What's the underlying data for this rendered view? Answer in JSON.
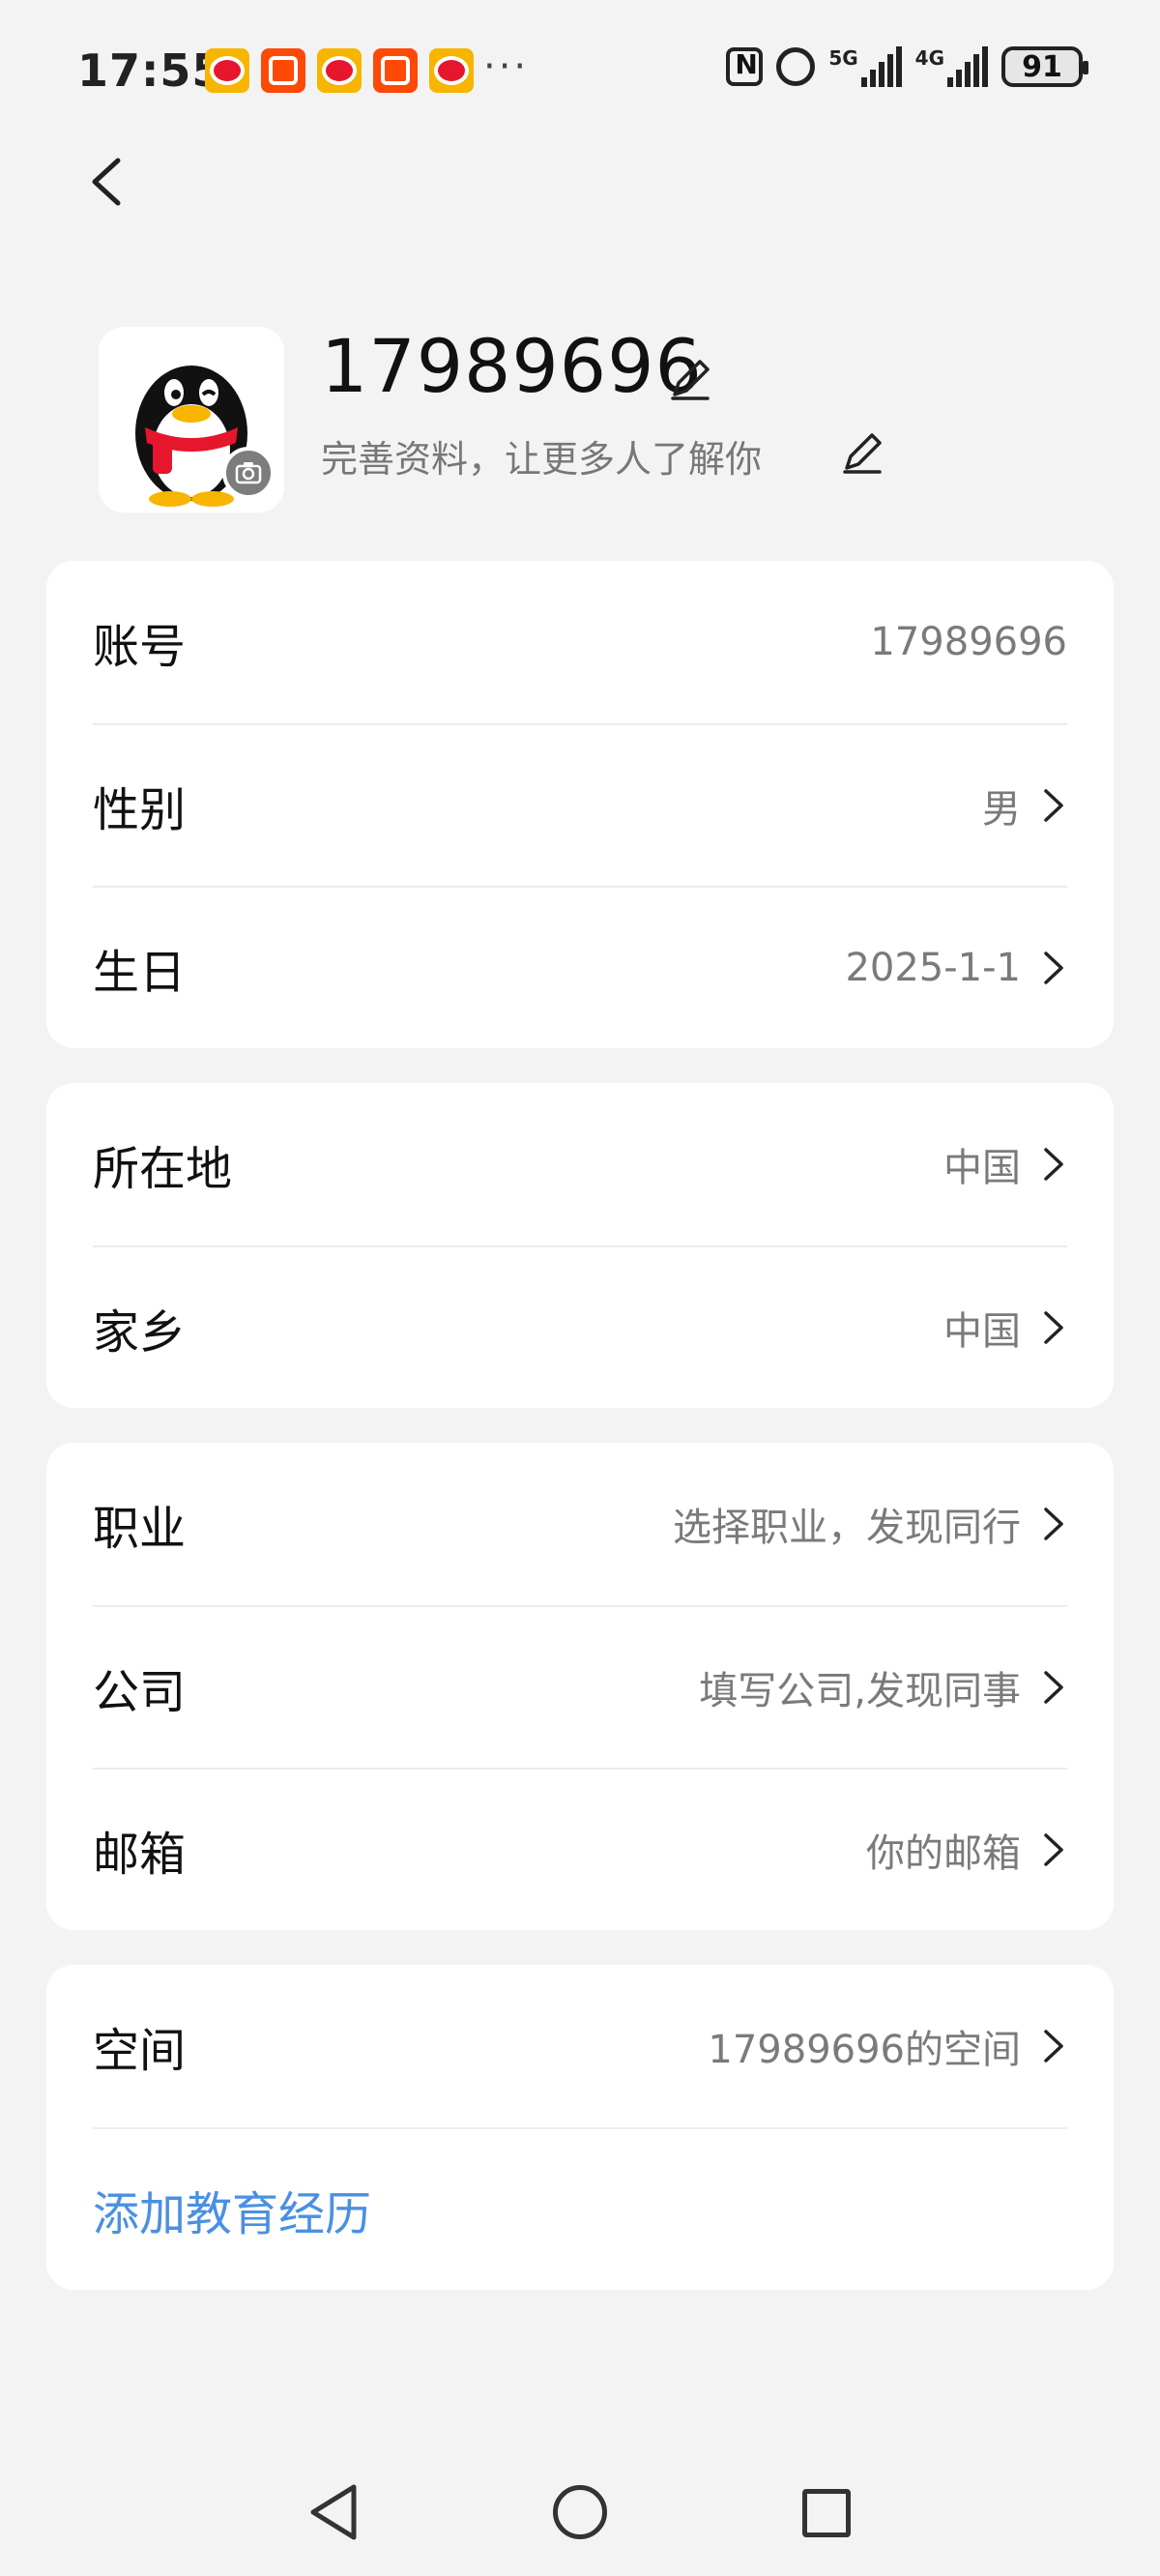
{
  "status_bar": {
    "time": "17:55",
    "notifications": [
      "weibo-icon",
      "kuaishou-icon",
      "weibo-icon",
      "kuaishou-icon",
      "weibo-icon"
    ],
    "more": "···",
    "battery": "91",
    "signal_1": "5G",
    "signal_2": "4G"
  },
  "profile": {
    "nickname": "17989696",
    "bio": "完善资料，让更多人了解你"
  },
  "card_basic": {
    "rows": [
      {
        "label": "账号",
        "value": "17989696"
      },
      {
        "label": "性别",
        "value": "男"
      },
      {
        "label": "生日",
        "value": "2025-1-1"
      }
    ]
  },
  "card_location": {
    "rows": [
      {
        "label": "所在地",
        "value": "中国"
      },
      {
        "label": "家乡",
        "value": "中国"
      }
    ]
  },
  "card_work": {
    "rows": [
      {
        "label": "职业",
        "value": "选择职业，发现同行"
      },
      {
        "label": "公司",
        "value": "填写公司,发现同事"
      },
      {
        "label": "邮箱",
        "value": "你的邮箱"
      }
    ]
  },
  "card_space": {
    "rows": [
      {
        "label": "空间",
        "value": "17989696的空间"
      }
    ],
    "add_education": "添加教育经历"
  },
  "colors": {
    "link": "#4a90e2",
    "background": "#f3f3f3"
  }
}
